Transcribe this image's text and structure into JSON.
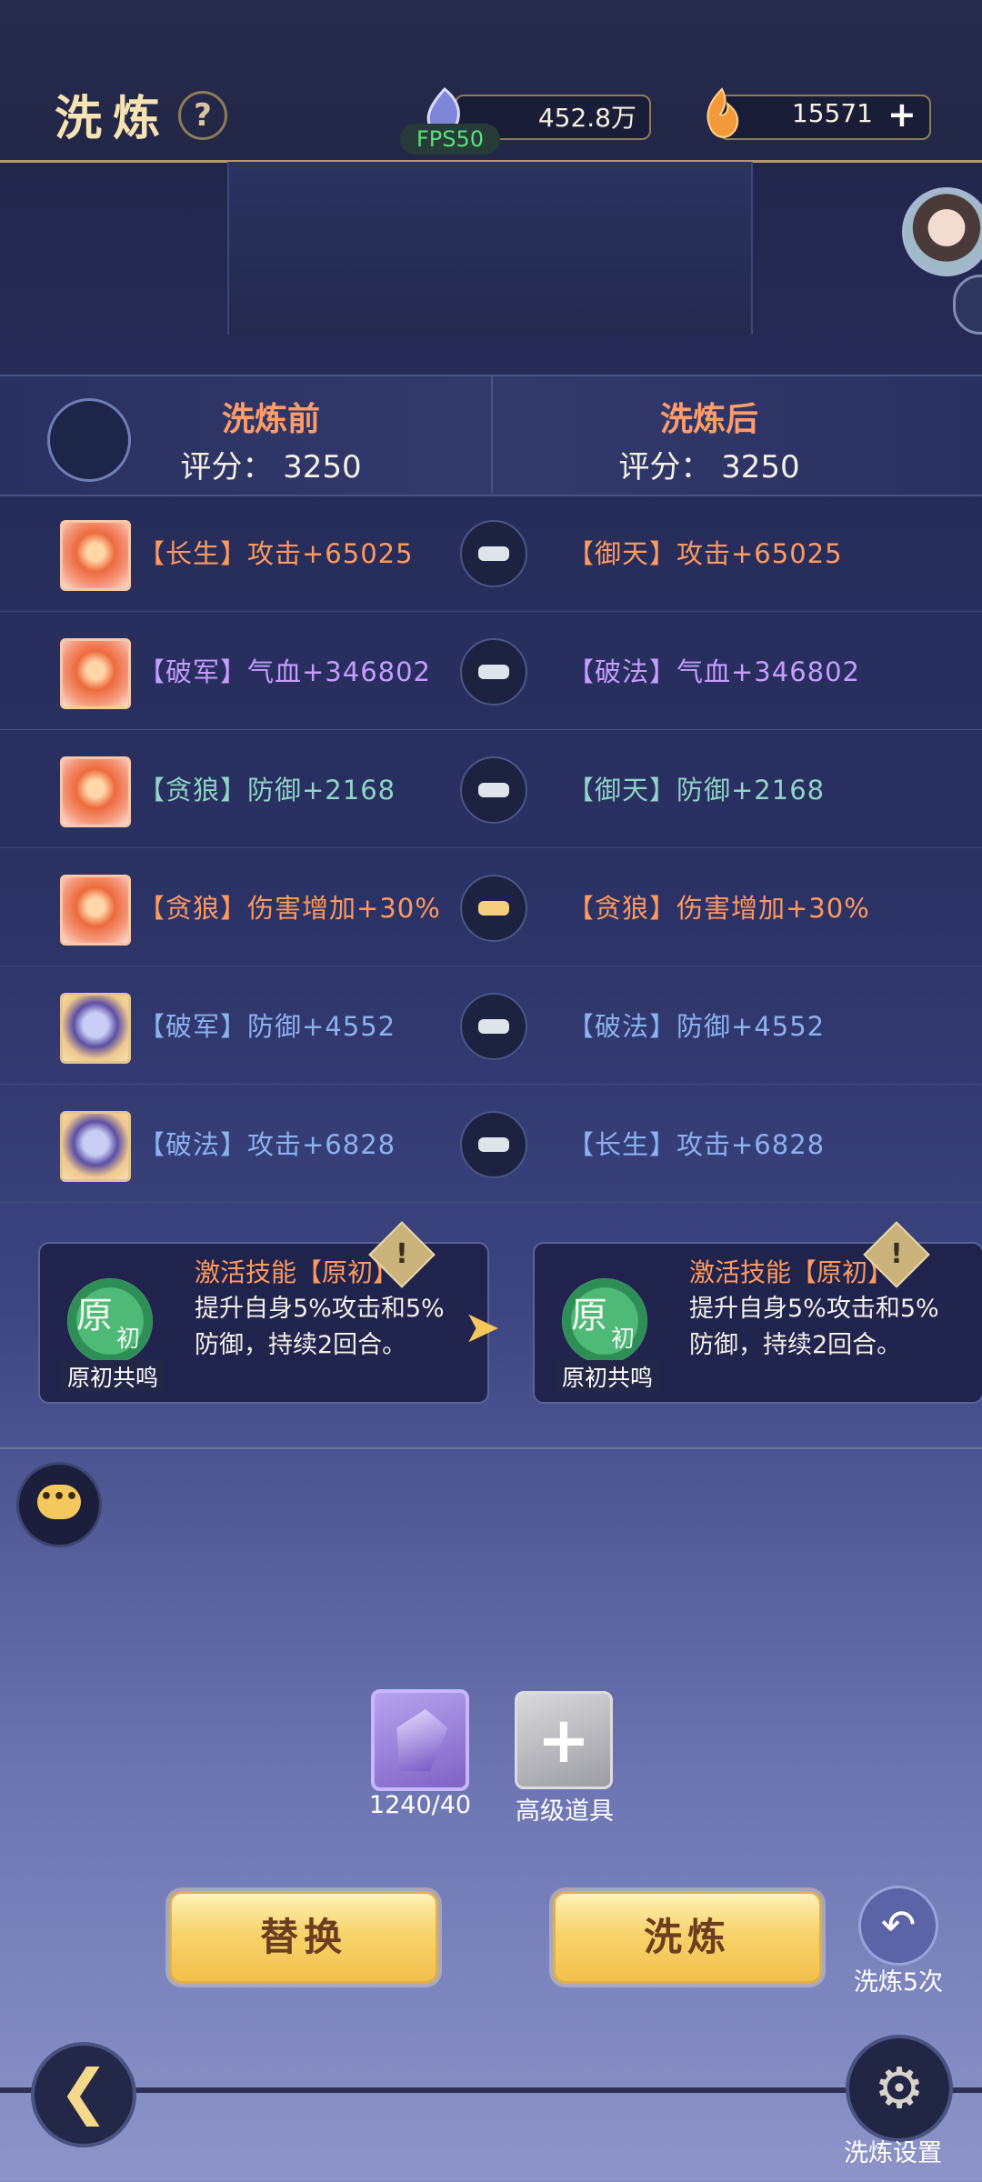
{
  "header": {
    "title": "洗炼",
    "help_icon": "?",
    "currency_1": "452.8万",
    "currency_2": "15571",
    "plus": "+",
    "fps": "FPS50"
  },
  "compare": {
    "before_title": "洗炼前",
    "after_title": "洗炼后",
    "before_score": "评分：  3250",
    "after_score": "评分：  3250"
  },
  "rows": [
    {
      "before": "【长生】攻击+65025",
      "after": "【御天】攻击+65025",
      "locked_active": false,
      "before_color": "#ff9a5f",
      "after_color": "#ff9a5f"
    },
    {
      "before": "【破军】气血+346802",
      "after": "【破法】气血+346802",
      "locked_active": false,
      "before_color": "#c69cff",
      "after_color": "#c69cff"
    },
    {
      "before": "【贪狼】防御+2168",
      "after": "【御天】防御+2168",
      "locked_active": false,
      "before_color": "#8fd4c5",
      "after_color": "#8fd4c5"
    },
    {
      "before": "【贪狼】伤害增加+30%",
      "after": "【贪狼】伤害增加+30%",
      "locked_active": true,
      "before_color": "#ff9a5f",
      "after_color": "#ff9a5f"
    },
    {
      "before": "【破军】防御+4552",
      "after": "【破法】防御+4552",
      "locked_active": false,
      "before_color": "#8bb2ee",
      "after_color": "#8bb2ee"
    },
    {
      "before": "【破法】攻击+6828",
      "after": "【长生】攻击+6828",
      "locked_active": false,
      "before_color": "#8bb2ee",
      "after_color": "#8bb2ee"
    }
  ],
  "skill": {
    "emblem_main": "原",
    "emblem_sub": "初",
    "tag": "原初共鸣",
    "title": "激活技能【原初】",
    "desc": "提升自身5%攻击和5%防御，持续2回合。",
    "warn": "!"
  },
  "materials": {
    "crystal_count": "1240/40",
    "advanced_item": "高级道具",
    "plus": "+"
  },
  "actions": {
    "replace": "替换",
    "refine": "洗炼",
    "refine5": "洗炼5次",
    "settings": "洗炼设置"
  },
  "icons": {
    "back": "back-arrow-icon",
    "settings": "gear-icon",
    "chat": "chat-icon"
  }
}
